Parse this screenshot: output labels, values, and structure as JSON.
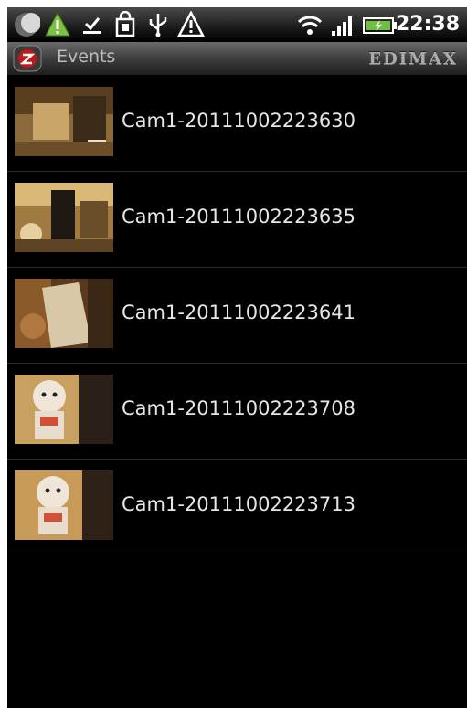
{
  "status_bar": {
    "time": "22:38",
    "icons": [
      "moon-icon",
      "warning-triangle-icon",
      "download-complete-icon",
      "shopping-bag-icon",
      "usb-icon",
      "debug-alert-icon",
      "wifi-icon",
      "signal-bars-icon",
      "battery-charging-icon"
    ]
  },
  "title_bar": {
    "title": "Events",
    "brand": "EDIMAX",
    "app_icon": "edimax-app-icon"
  },
  "events": [
    {
      "label": "Cam1-20111002223630",
      "thumbnail": "camera-snapshot-1"
    },
    {
      "label": "Cam1-20111002223635",
      "thumbnail": "camera-snapshot-2"
    },
    {
      "label": "Cam1-20111002223641",
      "thumbnail": "camera-snapshot-3"
    },
    {
      "label": "Cam1-20111002223708",
      "thumbnail": "camera-snapshot-4"
    },
    {
      "label": "Cam1-20111002223713",
      "thumbnail": "camera-snapshot-5"
    }
  ],
  "colors": {
    "background": "#000000",
    "list_text": "#e6e6e6",
    "title_text": "#bdbdbd",
    "divider": "#2a2a2a"
  }
}
